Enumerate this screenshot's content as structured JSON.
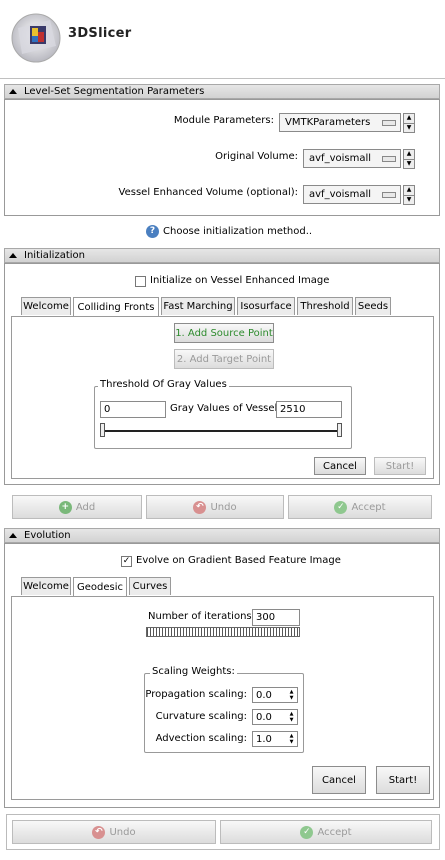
{
  "app": {
    "logo_text": "3DSlicer"
  },
  "levelset": {
    "header": "Level-Set Segmentation Parameters",
    "module_params_label": "Module Parameters:",
    "module_params_value": "VMTKParameters",
    "original_volume_label": "Original Volume:",
    "original_volume_value": "avf_voismall",
    "vessel_volume_label": "Vessel Enhanced Volume (optional):",
    "vessel_volume_value": "avf_voismall"
  },
  "choose_init": "Choose initialization method..",
  "initialization": {
    "header": "Initialization",
    "checkbox_label": "Initialize on Vessel Enhanced Image",
    "checkbox_checked": false,
    "tabs": [
      "Welcome",
      "Colliding Fronts",
      "Fast Marching",
      "Isosurface",
      "Threshold",
      "Seeds"
    ],
    "active_tab": "Colliding Fronts",
    "add_source_label": "1. Add Source Point",
    "add_target_label": "2. Add Target Point",
    "threshold_group_title": "Threshold Of Gray Values",
    "threshold_min": "0",
    "threshold_label": "Gray Values of Vessels",
    "threshold_max": "2510",
    "cancel_label": "Cancel",
    "start_label": "Start!"
  },
  "init_actions": {
    "add": "Add",
    "undo": "Undo",
    "accept": "Accept"
  },
  "evolution": {
    "header": "Evolution",
    "checkbox_label": "Evolve on Gradient Based Feature Image",
    "checkbox_checked": true,
    "tabs": [
      "Welcome",
      "Geodesic",
      "Curves"
    ],
    "active_tab": "Geodesic",
    "iterations_label": "Number of iterations",
    "iterations_value": "300",
    "scaling_title": "Scaling Weights:",
    "propagation_label": "Propagation scaling:",
    "propagation_value": "0.0",
    "curvature_label": "Curvature scaling:",
    "curvature_value": "0.0",
    "advection_label": "Advection scaling:",
    "advection_value": "1.0",
    "cancel_label": "Cancel",
    "start_label": "Start!"
  },
  "evo_actions": {
    "undo": "Undo",
    "accept": "Accept"
  },
  "icons": {
    "help": "help-icon",
    "add": "add-icon",
    "undo": "undo-icon",
    "accept": "accept-icon"
  },
  "colors": {
    "green_text": "#2e8b2e",
    "add_icon": "#7ab87a",
    "undo_icon": "#d89090",
    "accept_icon": "#8fc88f",
    "help_icon": "#4a7fc0"
  }
}
